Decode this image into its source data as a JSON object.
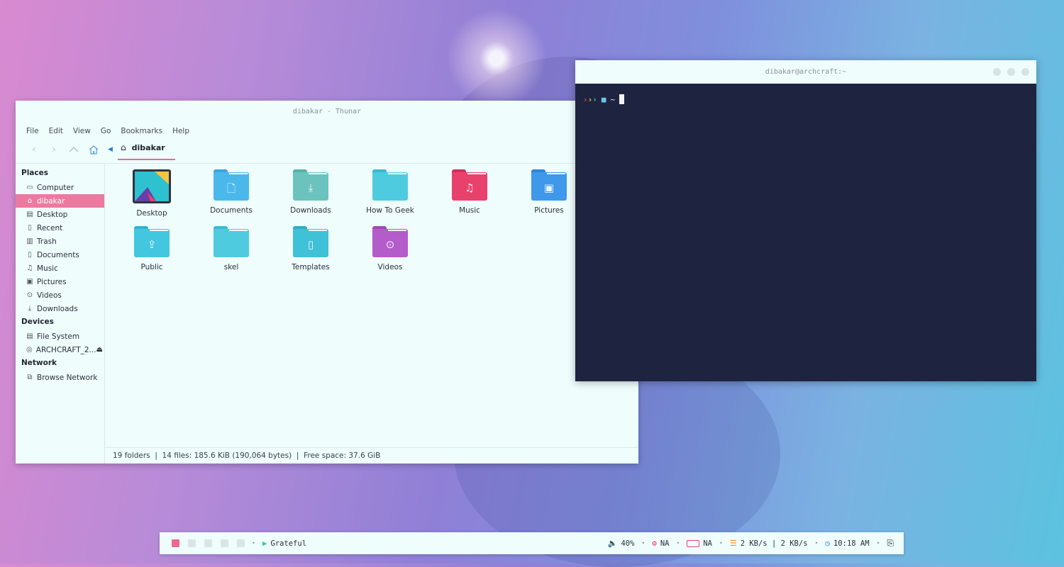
{
  "thunar": {
    "title": "dibakar - Thunar",
    "menu": [
      "File",
      "Edit",
      "View",
      "Go",
      "Bookmarks",
      "Help"
    ],
    "location": "dibakar",
    "sidebar": {
      "places_heading": "Places",
      "places": [
        {
          "label": "Computer",
          "icon": "computer-icon"
        },
        {
          "label": "dibakar",
          "icon": "home-icon",
          "active": true
        },
        {
          "label": "Desktop",
          "icon": "desktop-icon"
        },
        {
          "label": "Recent",
          "icon": "recent-icon"
        },
        {
          "label": "Trash",
          "icon": "trash-icon"
        },
        {
          "label": "Documents",
          "icon": "document-icon"
        },
        {
          "label": "Music",
          "icon": "music-icon"
        },
        {
          "label": "Pictures",
          "icon": "picture-icon"
        },
        {
          "label": "Videos",
          "icon": "video-icon"
        },
        {
          "label": "Downloads",
          "icon": "download-icon"
        }
      ],
      "devices_heading": "Devices",
      "devices": [
        {
          "label": "File System",
          "icon": "drive-icon"
        },
        {
          "label": "ARCHCRAFT_2...",
          "icon": "disc-icon"
        }
      ],
      "network_heading": "Network",
      "network": [
        {
          "label": "Browse Network",
          "icon": "network-icon"
        }
      ]
    },
    "files": [
      {
        "name": "Desktop",
        "color": "#2ec1cf",
        "icon": "desktop-thumbnail"
      },
      {
        "name": "Documents",
        "color": "#4ab8ea",
        "icon": "document-icon"
      },
      {
        "name": "Downloads",
        "color": "#6cc3bd",
        "icon": "download-icon"
      },
      {
        "name": "How To Geek",
        "color": "#4fcbe0",
        "icon": "folder-icon"
      },
      {
        "name": "Music",
        "color": "#e8426c",
        "icon": "music-icon"
      },
      {
        "name": "Pictures",
        "color": "#3f98ea",
        "icon": "picture-icon"
      },
      {
        "name": "Public",
        "color": "#43c6e0",
        "icon": "share-icon"
      },
      {
        "name": "skel",
        "color": "#4fcbe0",
        "icon": "folder-icon"
      },
      {
        "name": "Templates",
        "color": "#3fc1d8",
        "icon": "template-icon"
      },
      {
        "name": "Videos",
        "color": "#b45cc9",
        "icon": "video-icon"
      }
    ],
    "status": "19 folders  |  14 files: 185.6 KiB (190,064 bytes)  |  Free space: 37.6 GiB"
  },
  "terminal": {
    "title": "dibakar@archcraft:~",
    "prompt_dir": "~"
  },
  "panel": {
    "now_playing": "Grateful",
    "volume": "40%",
    "cpu": "NA",
    "battery": "NA",
    "network": "2 KB/s | 2 KB/s",
    "time": "10:18 AM",
    "colors": {
      "accent": "#ec6a92",
      "play": "#3ecb93",
      "volume": "#c04fd0",
      "cpu": "#e8325a",
      "battery": "#e8426c",
      "net": "#f09030",
      "clock": "#3a8ee8"
    }
  }
}
